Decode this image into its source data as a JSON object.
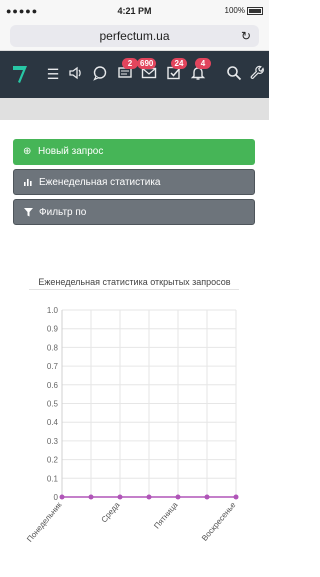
{
  "status_bar": {
    "left": "●●●●● ",
    "time": "4:21 PM",
    "battery": "100%"
  },
  "browser": {
    "url": "perfectum.ua"
  },
  "navbar": {
    "badges": {
      "chat": "2",
      "mail": "690",
      "tasks": "24",
      "bell": "4"
    },
    "colors": {
      "bg": "#2b3641",
      "logo": "#28c7a5",
      "badge": "#e2455d"
    }
  },
  "buttons": {
    "new_request": "Новый запрос",
    "weekly_stats": "Еженедельная статистика",
    "filter": "Фильтр по"
  },
  "chart_data": {
    "type": "line",
    "title": "Еженедельная статистика открытых запросов",
    "ylim": [
      0,
      1.0
    ],
    "yticks": [
      "1.0",
      "0.9",
      "0.8",
      "0.7",
      "0.6",
      "0.5",
      "0.4",
      "0.3",
      "0.2",
      "0.1",
      "0"
    ],
    "x_labels_visible": [
      "Понедельник",
      "Среда",
      "Пятница",
      "Воскресенье"
    ],
    "values": [
      0,
      0,
      0,
      0,
      0,
      0,
      0
    ],
    "grid": true,
    "series_color": "#b055b8"
  }
}
